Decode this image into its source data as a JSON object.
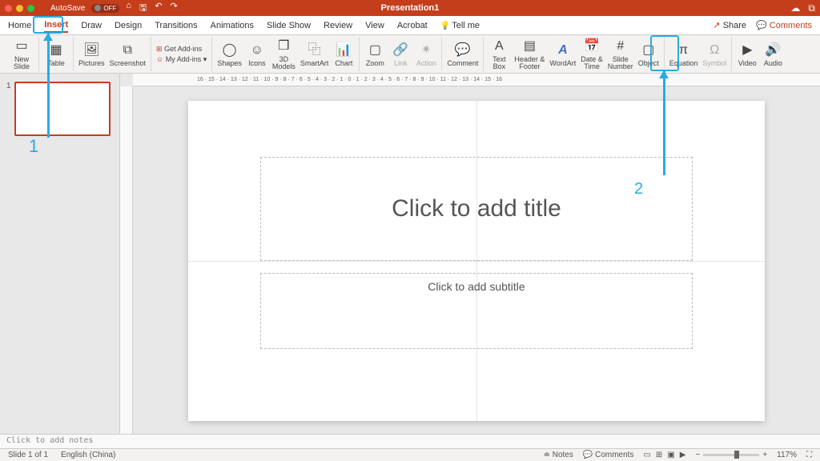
{
  "window": {
    "title": "Presentation1",
    "autosave_label": "AutoSave",
    "autosave_state": "OFF"
  },
  "tabs": {
    "items": [
      "Home",
      "Insert",
      "Draw",
      "Design",
      "Transitions",
      "Animations",
      "Slide Show",
      "Review",
      "View",
      "Acrobat"
    ],
    "tell_me": "Tell me",
    "active": "Insert",
    "share": "Share",
    "comments": "Comments"
  },
  "ribbon": {
    "new_slide": "New\nSlide",
    "table": "Table",
    "pictures": "Pictures",
    "screenshot": "Screenshot",
    "get_addins": "Get Add-ins",
    "my_addins": "My Add-ins",
    "shapes": "Shapes",
    "icons": "Icons",
    "models": "3D\nModels",
    "smartart": "SmartArt",
    "chart": "Chart",
    "zoom": "Zoom",
    "link": "Link",
    "action": "Action",
    "comment": "Comment",
    "textbox": "Text\nBox",
    "header": "Header &\nFooter",
    "wordart": "WordArt",
    "date": "Date &\nTime",
    "slideno": "Slide\nNumber",
    "object": "Object",
    "equation": "Equation",
    "symbol": "Symbol",
    "video": "Video",
    "audio": "Audio"
  },
  "slide": {
    "thumb_num": "1",
    "title_placeholder": "Click to add title",
    "subtitle_placeholder": "Click to add subtitle"
  },
  "notes": {
    "placeholder": "Click to add notes"
  },
  "status": {
    "slide": "Slide 1 of 1",
    "lang": "English (China)",
    "notes": "Notes",
    "comments": "Comments",
    "zoom": "117%"
  },
  "annotations": {
    "num1": "1",
    "num2": "2"
  }
}
